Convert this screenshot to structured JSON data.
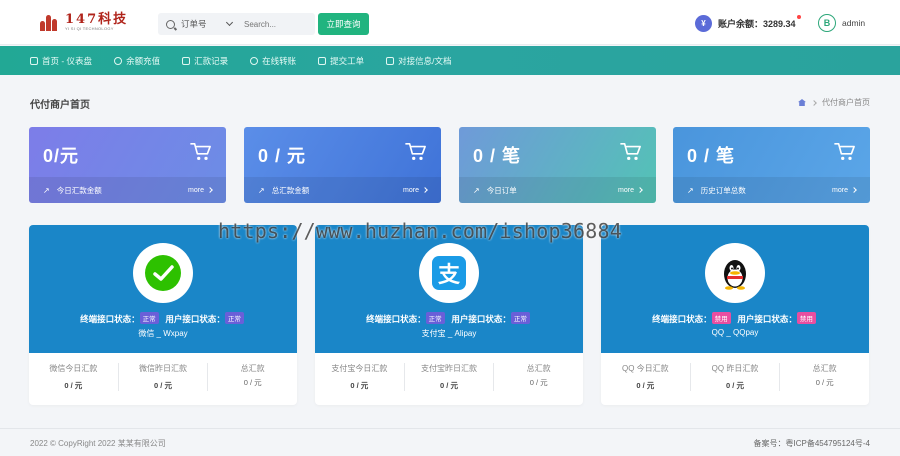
{
  "header": {
    "logo_text": "147科技",
    "logo_subtext": "YI SI QI TECHNOLOGY",
    "search_select": "订单号",
    "search_placeholder": "Search...",
    "search_button": "立即查询",
    "balance_symbol": "¥",
    "balance_label": "账户余额：3289.34",
    "avatar_letter": "B",
    "user_name": "admin"
  },
  "nav": [
    {
      "label": "首页 - 仪表盘",
      "icon": "home-icon"
    },
    {
      "label": "余额充值",
      "icon": "wallet-icon"
    },
    {
      "label": "汇款记录",
      "icon": "chart-icon"
    },
    {
      "label": "在线转账",
      "icon": "transfer-icon"
    },
    {
      "label": "提交工单",
      "icon": "ticket-icon"
    },
    {
      "label": "对接信息/文档",
      "icon": "document-icon"
    }
  ],
  "page": {
    "title": "代付商户首页",
    "breadcrumb": "代付商户首页"
  },
  "stats": [
    {
      "value": "0/元",
      "label": "今日汇款金额",
      "more": "more"
    },
    {
      "value": "0 / 元",
      "label": "总汇款金额",
      "more": "more"
    },
    {
      "value": "0 / 笔",
      "label": "今日订单",
      "more": "more"
    },
    {
      "value": "0 / 笔",
      "label": "历史订单总数",
      "more": "more"
    }
  ],
  "payments": [
    {
      "name": "微信 _ Wxpay",
      "logo": "wechat-icon",
      "terminal_label": "终端接口状态：",
      "terminal_status": "正常",
      "user_label": "用户接口状态：",
      "user_status": "正常",
      "today_label": "微信今日汇款",
      "today_value": "0 / 元",
      "yesterday_label": "微信昨日汇款",
      "yesterday_value": "0 / 元",
      "total_label": "总汇款",
      "total_value": "0 / 元"
    },
    {
      "name": "支付宝 _ Alipay",
      "logo": "alipay-icon",
      "terminal_label": "终端接口状态：",
      "terminal_status": "正常",
      "user_label": "用户接口状态：",
      "user_status": "正常",
      "today_label": "支付宝今日汇款",
      "today_value": "0 / 元",
      "yesterday_label": "支付宝昨日汇款",
      "yesterday_value": "0 / 元",
      "total_label": "总汇款",
      "total_value": "0 / 元"
    },
    {
      "name": "QQ _ QQpay",
      "logo": "qq-icon",
      "terminal_label": "终端接口状态：",
      "terminal_status": "禁用",
      "user_label": "用户接口状态：",
      "user_status": "禁用",
      "today_label": "QQ 今日汇款",
      "today_value": "0 / 元",
      "yesterday_label": "QQ 昨日汇款",
      "yesterday_value": "0 / 元",
      "total_label": "总汇款",
      "total_value": "0 / 元"
    }
  ],
  "watermark": "https://www.huzhan.com/ishop36884",
  "footer": {
    "copyright": "2022 © CopyRight 2022 某某有限公司",
    "icp": "备案号：粤ICP备454795124号-4"
  },
  "colors": {
    "nav_bg": "#22a895",
    "search_button": "#21b47f",
    "pay_card_bg": "#1a86c8",
    "tag_ok": "#6a5fd8",
    "tag_off": "#e84ea0"
  }
}
